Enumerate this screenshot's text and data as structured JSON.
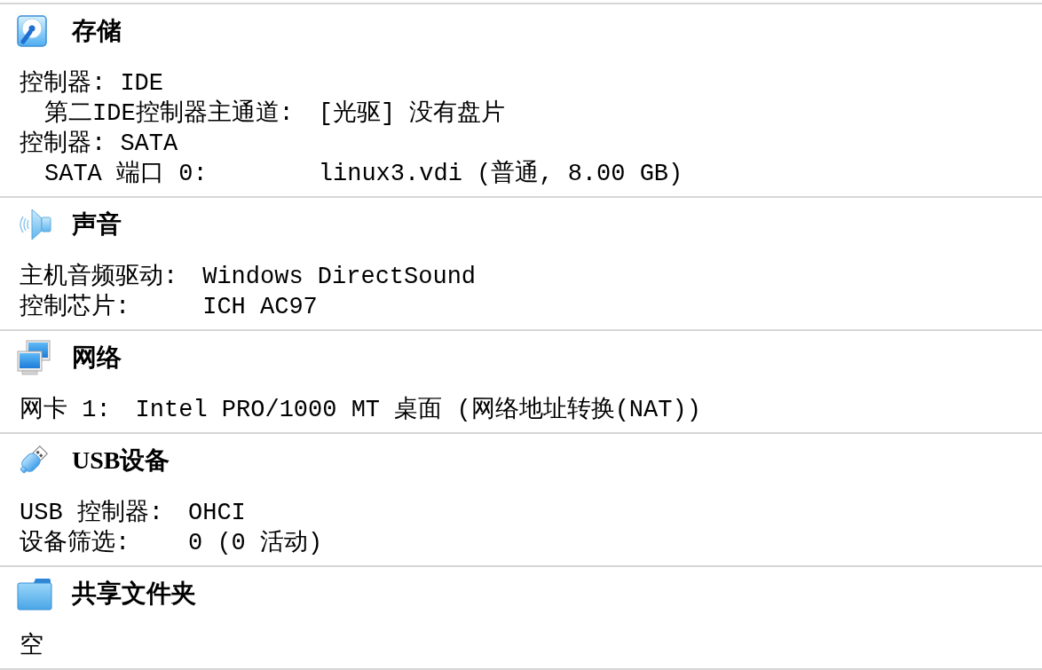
{
  "sections": [
    {
      "kind": "storage",
      "title": "存储",
      "rows": [
        {
          "kind": "controller",
          "text": "控制器: IDE",
          "children": [
            {
              "label": "第二IDE控制器主通道:",
              "value": "[光驱] 没有盘片"
            }
          ]
        },
        {
          "kind": "controller",
          "text": "控制器: SATA",
          "children": [
            {
              "label": "SATA 端口 0:",
              "value": "linux3.vdi (普通, 8.00 GB)"
            }
          ]
        }
      ]
    },
    {
      "kind": "audio",
      "title": "声音",
      "rows": [
        {
          "kind": "entry",
          "label": "主机音频驱动:",
          "value": "Windows DirectSound"
        },
        {
          "kind": "entry",
          "label": "控制芯片:",
          "value": "ICH AC97"
        }
      ]
    },
    {
      "kind": "network",
      "title": "网络",
      "rows": [
        {
          "kind": "entry",
          "label": "网卡 1:",
          "value": "Intel PRO/1000 MT 桌面 (网络地址转换(NAT))"
        }
      ]
    },
    {
      "kind": "usb",
      "title": "USB设备",
      "rows": [
        {
          "kind": "entry",
          "label": "USB 控制器:",
          "value": "OHCI"
        },
        {
          "kind": "entry",
          "label": "设备筛选:",
          "value": "0 (0 活动)"
        }
      ]
    },
    {
      "kind": "shared-folders",
      "title": "共享文件夹",
      "rows": [
        {
          "kind": "text",
          "text": "空"
        }
      ]
    }
  ]
}
